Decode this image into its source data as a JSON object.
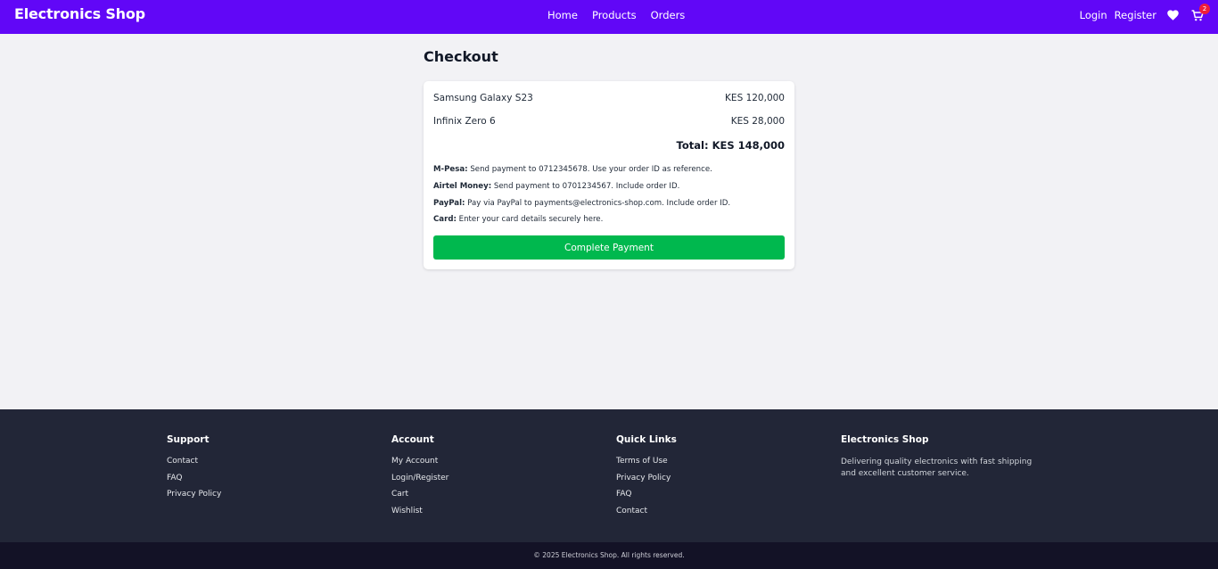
{
  "navbar": {
    "brand": "Electronics Shop",
    "links": [
      "Home",
      "Products",
      "Orders"
    ],
    "login": "Login",
    "register": "Register",
    "cart_count": "2",
    "color": "#6107f7"
  },
  "checkout": {
    "title": "Checkout",
    "items": [
      {
        "name": "Samsung Galaxy S23",
        "price": "KES 120,000"
      },
      {
        "name": "Infinix Zero 6",
        "price": "KES 28,000"
      }
    ],
    "total": "Total: KES 148,000",
    "payment_methods": [
      {
        "label": "M-Pesa:",
        "text": " Send payment to 0712345678. Use your order ID as reference."
      },
      {
        "label": "Airtel Money:",
        "text": " Send payment to 0701234567. Include order ID."
      },
      {
        "label": "PayPal:",
        "text": " Pay via PayPal to payments@electronics-shop.com. Include order ID."
      },
      {
        "label": "Card:",
        "text": " Enter your card details securely here."
      }
    ],
    "button": "Complete Payment",
    "button_color": "#00b84e"
  },
  "footer": {
    "support": {
      "title": "Support",
      "links": [
        "Contact",
        "FAQ",
        "Privacy Policy"
      ]
    },
    "account": {
      "title": "Account",
      "links": [
        "My Account",
        "Login/Register",
        "Cart",
        "Wishlist"
      ]
    },
    "quick_links": {
      "title": "Quick Links",
      "links": [
        "Terms of Use",
        "Privacy Policy",
        "FAQ",
        "Contact"
      ]
    },
    "about": {
      "title": "Electronics Shop",
      "text": "Delivering quality electronics with fast shipping and excellent customer service."
    },
    "copyright": "© 2025 Electronics Shop. All rights reserved."
  }
}
